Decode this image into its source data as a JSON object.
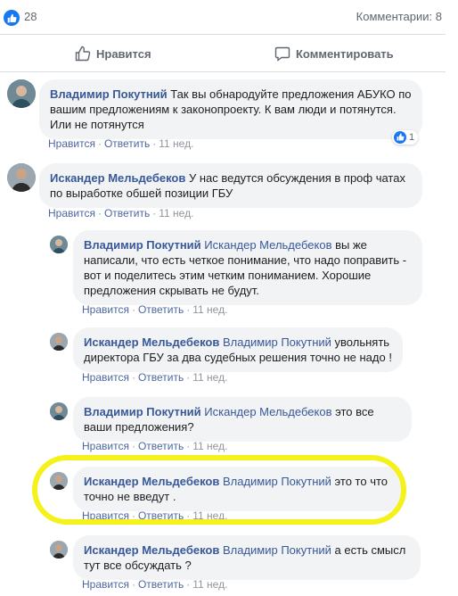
{
  "post": {
    "likes_count": "28",
    "comments_count": "Комментарии: 8",
    "like_button": "Нравится",
    "comment_button": "Комментировать"
  },
  "comments": [
    {
      "author": "Владимир Покутний",
      "mention": "",
      "text": "Так вы обнародуйте предложения АБУКО по вашим предложениям к законопроекту. К вам люди и потянутся. Или не потянутся",
      "like_label": "Нравится",
      "reply_label": "Ответить",
      "time": "11 нед.",
      "reaction_count": "1"
    },
    {
      "author": "Искандер Мельдебеков",
      "mention": "",
      "text": "У нас ведутся обсуждения в проф чатах по выработке обшей позиции ГБУ",
      "like_label": "Нравится",
      "reply_label": "Ответить",
      "time": "11 нед."
    }
  ],
  "replies": [
    {
      "author": "Владимир Покутний",
      "mention": "Искандер Мельдебеков",
      "text": "вы же написали, что есть четкое понимание, что надо поправить - вот и поделитесь этим четким пониманием. Хорошие предложения скрывать не будут.",
      "like_label": "Нравится",
      "reply_label": "Ответить",
      "time": "11 нед."
    },
    {
      "author": "Искандер Мельдебеков",
      "mention": "Владимир Покутний",
      "text": "увольнять директора ГБУ за два судебных решения точно не надо !",
      "like_label": "Нравится",
      "reply_label": "Ответить",
      "time": "11 нед."
    },
    {
      "author": "Владимир Покутний",
      "mention": "Искандер Мельдебеков",
      "text": "это все ваши предложения?",
      "like_label": "Нравится",
      "reply_label": "Ответить",
      "time": "11 нед."
    },
    {
      "author": "Искандер Мельдебеков",
      "mention": "Владимир Покутний",
      "text": "это то что точно не введут .",
      "like_label": "Нравится",
      "reply_label": "Ответить",
      "time": "11 нед."
    },
    {
      "author": "Искандер Мельдебеков",
      "mention": "Владимир Покутний",
      "text": "а есть смысл тут все обсуждать ?",
      "like_label": "Нравится",
      "reply_label": "Ответить",
      "time": "11 нед."
    }
  ],
  "colors": {
    "link": "#385898",
    "bubble": "#f2f3f5",
    "highlight": "#f4f11b",
    "like_blue": "#1877f2"
  }
}
